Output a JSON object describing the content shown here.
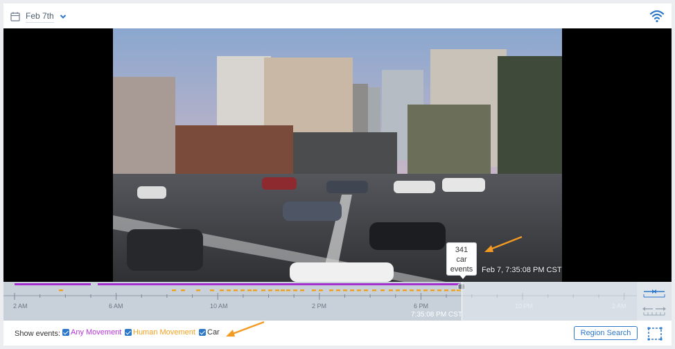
{
  "header": {
    "date_label": "Feb 7th",
    "icons": [
      "calendar-icon",
      "chevron-down-icon",
      "wifi-icon"
    ]
  },
  "video": {
    "tooltip": {
      "count": "341",
      "kind": "car",
      "word": "events"
    },
    "timestamp": "Feb 7, 7:35:08 PM CST"
  },
  "timeline": {
    "ticks": [
      "2 AM",
      "6 AM",
      "10 AM",
      "2 PM",
      "6 PM",
      "10 PM",
      "2 AM"
    ],
    "cursor_label": "7:35:08 PM CST",
    "colors": {
      "any_movement": "#a62fd0",
      "human_movement": "#f0a11e",
      "track": "#c8d1da"
    }
  },
  "footer": {
    "show_label": "Show events:",
    "checkboxes": [
      {
        "label": "Any Movement",
        "checked": true,
        "color": "#b732d9"
      },
      {
        "label": "Human Movement",
        "checked": true,
        "color": "#f0a11e"
      },
      {
        "label": "Car",
        "checked": true,
        "color": "#333333"
      }
    ],
    "region_search_label": "Region Search"
  },
  "colors": {
    "accent": "#2d78c8",
    "annotation_arrow": "#f29a22"
  }
}
